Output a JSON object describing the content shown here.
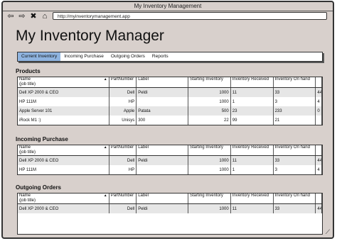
{
  "window": {
    "title": "My Inventory Management"
  },
  "nav": {
    "back": "⇦",
    "forward": "⇨",
    "stop": "✖",
    "home": "⌂",
    "url": "http://myinventorymanagement.app"
  },
  "page": {
    "title": "My Inventory Manager"
  },
  "tabs": [
    "Current Inventory",
    "Incoming Purchase",
    "Outgoing Orders",
    "Reports"
  ],
  "columns": {
    "name": "Name",
    "job": "(job title)",
    "part": "PartNumber",
    "label": "Label",
    "start": "Starting Inventory",
    "recv": "Inventory Received",
    "hand": "Inventory On hand",
    "extra": ""
  },
  "sort_icon": "▲",
  "products": {
    "title": "Products",
    "rows": [
      {
        "name": "Dell XP 2000 & CEO",
        "part": "Dell",
        "label": "Peldi",
        "start": "1000",
        "recv": "11",
        "hand": "33",
        "extra": "44"
      },
      {
        "name": "HP 111M",
        "part": "HP",
        "label": "",
        "start": "1000",
        "recv": "1",
        "hand": "3",
        "extra": "4"
      },
      {
        "name": "Apple Server 101",
        "part": "Apple",
        "label": "Patata",
        "start": "500",
        "recv": "23",
        "hand": "233",
        "extra": "0"
      },
      {
        "name": "iRock M1 :)",
        "part": "Unisys",
        "label": "300",
        "start": "22",
        "recv": "99",
        "hand": "21",
        "extra": ""
      }
    ]
  },
  "incoming": {
    "title": "Incoming Purchase",
    "rows": [
      {
        "name": "Dell XP 2000 & CEO",
        "part": "Dell",
        "label": "Peldi",
        "start": "1000",
        "recv": "11",
        "hand": "33",
        "extra": "44"
      },
      {
        "name": "HP 111M",
        "part": "HP",
        "label": "",
        "start": "1000",
        "recv": "1",
        "hand": "3",
        "extra": "4"
      }
    ]
  },
  "outgoing": {
    "title": "Outgoing Orders",
    "rows": [
      {
        "name": "Dell XP 2000 & CEO",
        "part": "Dell",
        "label": "Peldi",
        "start": "1000",
        "recv": "11",
        "hand": "33",
        "extra": "44"
      }
    ]
  }
}
